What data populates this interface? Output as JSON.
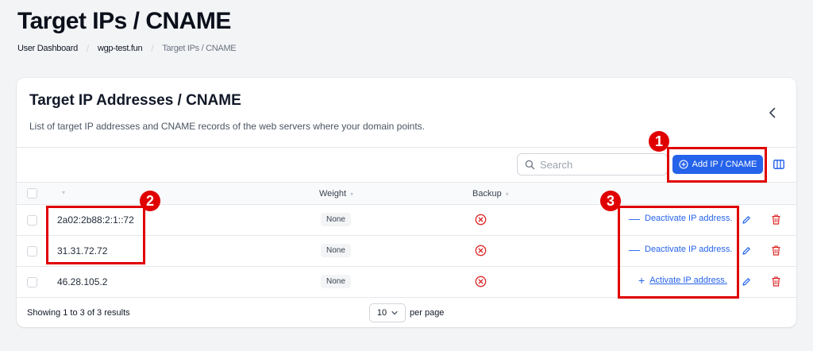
{
  "page": {
    "title": "Target IPs / CNAME",
    "breadcrumb": [
      "User Dashboard",
      "wgp-test.fun",
      "Target IPs / CNAME"
    ]
  },
  "card": {
    "title": "Target IP Addresses / CNAME",
    "description": "List of target IP addresses and CNAME records of the web servers where your domain points."
  },
  "toolbar": {
    "search_placeholder": "Search",
    "add_label": "Add IP / CNAME"
  },
  "table": {
    "columns": [
      "",
      "Weight",
      "Backup"
    ],
    "rows": [
      {
        "ip": "2a02:2b88:2:1::72",
        "weight": "None",
        "backup": "no",
        "action_sign": "—",
        "action": "Deactivate IP address."
      },
      {
        "ip": "31.31.72.72",
        "weight": "None",
        "backup": "no",
        "action_sign": "—",
        "action": "Deactivate IP address."
      },
      {
        "ip": "46.28.105.2",
        "weight": "None",
        "backup": "no",
        "action_sign": "+",
        "action": "Activate IP address."
      }
    ]
  },
  "footer": {
    "results_text": "Showing 1 to 3 of 3 results",
    "per_page_value": "10",
    "per_page_label": "per page"
  },
  "annotations": [
    "1",
    "2",
    "3"
  ],
  "colors": {
    "accent": "#2563eb",
    "annotation": "#e00000",
    "danger": "#dc2626"
  }
}
